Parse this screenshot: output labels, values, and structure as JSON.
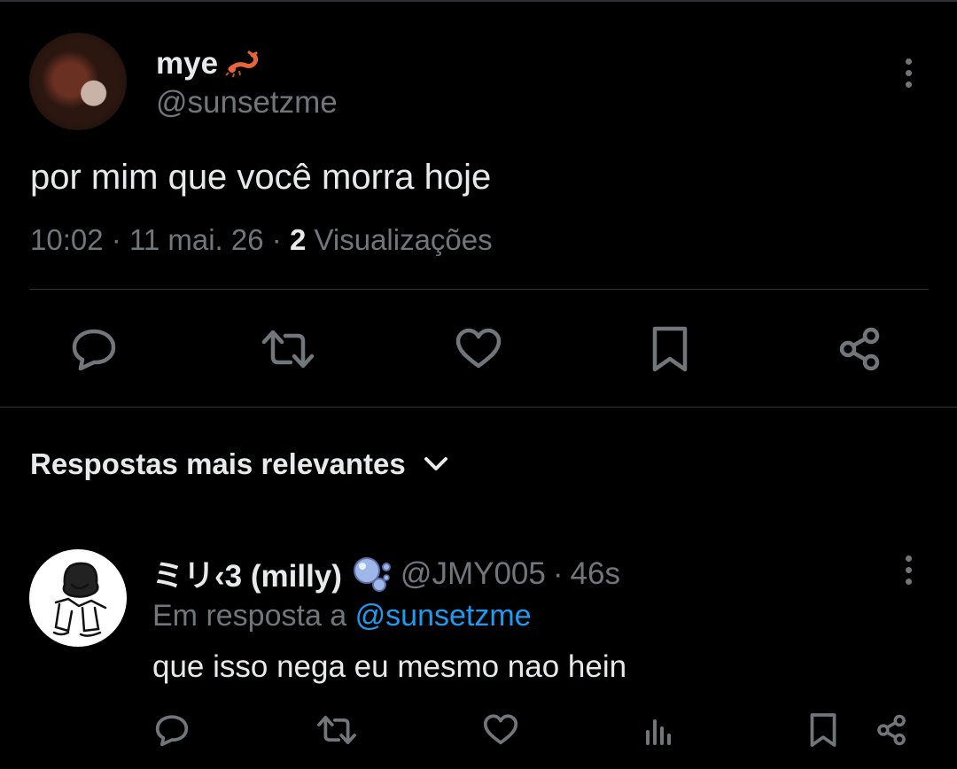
{
  "tweet": {
    "display_name": "mye",
    "name_emoji": "scorpion-emoji",
    "handle": "@sunsetzme",
    "text": "por mim que você morra hoje",
    "time": "10:02",
    "date": "11 mai. 26",
    "views_count": "2",
    "views_label": "Visualizações",
    "separator": "·"
  },
  "actions": [
    "reply-icon",
    "retweet-icon",
    "like-icon",
    "bookmark-icon",
    "share-icon"
  ],
  "replies_sort": {
    "label": "Respostas mais relevantes"
  },
  "reply": {
    "display_name": "ミリ‹3 (milly)",
    "name_emoji": "bubbles-emoji",
    "handle": "@JMY005",
    "time": "46s",
    "separator": "·",
    "in_reply_prefix": "Em resposta a",
    "in_reply_handle": "@sunsetzme",
    "text": "que isso nega eu mesmo nao hein"
  },
  "reply_actions": [
    "reply-icon",
    "retweet-icon",
    "like-icon",
    "views-icon",
    "bookmark-icon",
    "share-icon"
  ],
  "colors": {
    "background": "#000000",
    "text": "#e7e9ea",
    "muted": "#71767b",
    "link": "#1d9bf0",
    "divider": "#2f3336"
  }
}
